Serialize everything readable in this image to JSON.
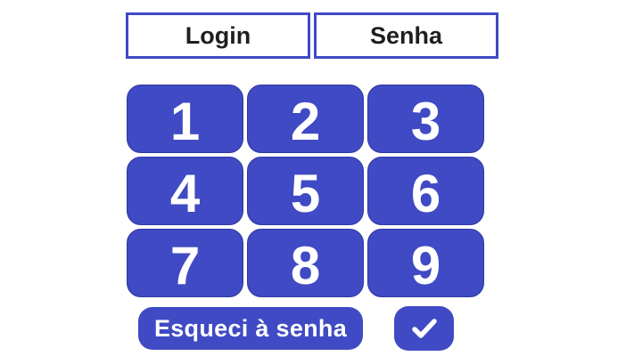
{
  "fields": {
    "login_label": "Login",
    "senha_label": "Senha"
  },
  "keypad": {
    "keys": [
      "1",
      "2",
      "3",
      "4",
      "5",
      "6",
      "7",
      "8",
      "9"
    ]
  },
  "actions": {
    "forgot_label": "Esqueci à senha",
    "confirm_icon": "check-icon"
  },
  "colors": {
    "accent": "#3f4ac4",
    "background": "#ffffff",
    "field_text": "#1f1f1f",
    "key_text": "#ffffff"
  }
}
